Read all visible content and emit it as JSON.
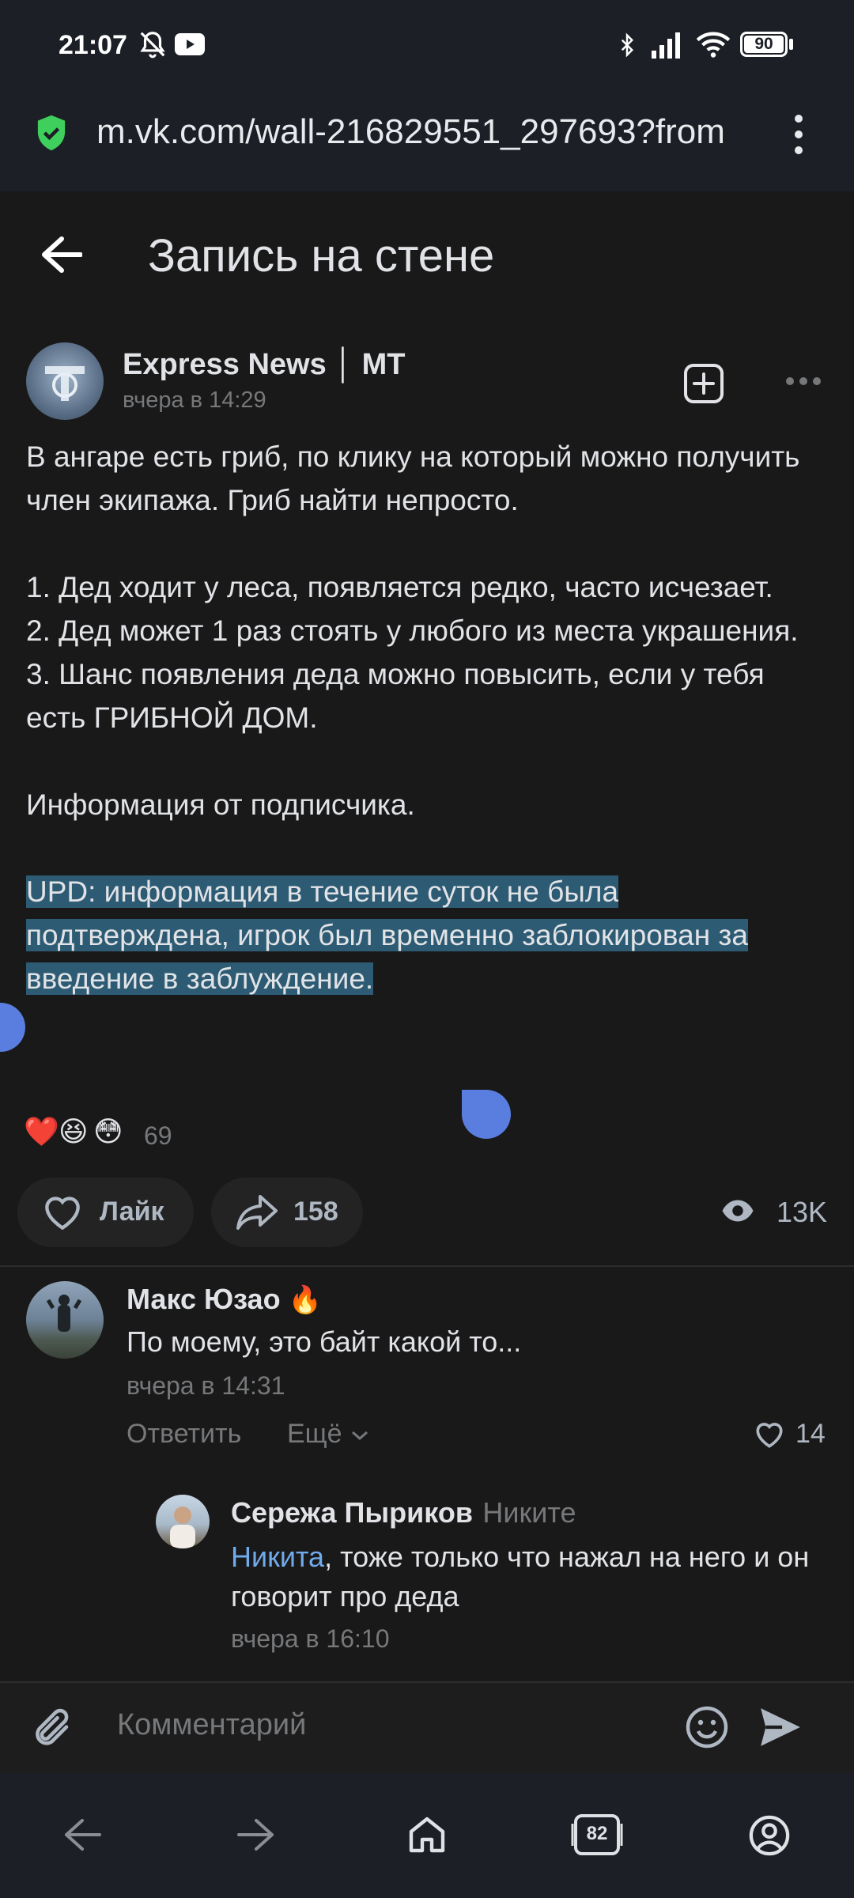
{
  "status_bar": {
    "time": "21:07",
    "battery": "90",
    "icons": [
      "bell-off-icon",
      "youtube-icon",
      "bluetooth-icon",
      "signal-icon",
      "wifi-icon",
      "battery-icon"
    ]
  },
  "browser": {
    "url": "m.vk.com/wall-216829551_297693?from",
    "secure_icon": "shield-check-icon",
    "menu_icon": "kebab-menu-icon"
  },
  "header": {
    "title": "Запись на стене",
    "back_icon": "arrow-left-icon"
  },
  "post": {
    "author": "Express News │ MT",
    "date": "вчера в 14:29",
    "paragraphs": [
      "В ангаре есть гриб, по клику на который можно получить член экипажа. Гриб найти непросто.",
      "1. Дед ходит у леса, появляется редко, часто исчезает.\n2. Дед может 1 раз стоять у любого из места украшения.\n3. Шанс появления деда можно повысить, если у тебя есть ГРИБНОЙ ДОМ.",
      "Информация от подписчика."
    ],
    "highlighted_text": "UPD: информация в течение суток не была подтверждена, игрок был временно заблокирован за введение в заблуждение.",
    "reactions": [
      "❤️",
      "😆",
      "😳"
    ],
    "reaction_count": "69",
    "like_label": "Лайк",
    "share_count": "158",
    "views": "13K"
  },
  "comments": [
    {
      "author": "Макс Юзао",
      "badge": "🔥",
      "text": "По моему, это байт какой то...",
      "date": "вчера в 14:31",
      "reply_label": "Ответить",
      "more_label": "Ещё",
      "likes": "14"
    },
    {
      "author": "Сережа Пыриков",
      "reply_to": "Никите",
      "mention": "Никита",
      "text": ", тоже только что нажал на него и он говорит про деда",
      "date": "вчера в 16:10"
    }
  ],
  "comment_input": {
    "placeholder": "Комментарий"
  },
  "nav": {
    "tabs_count": "82"
  }
}
